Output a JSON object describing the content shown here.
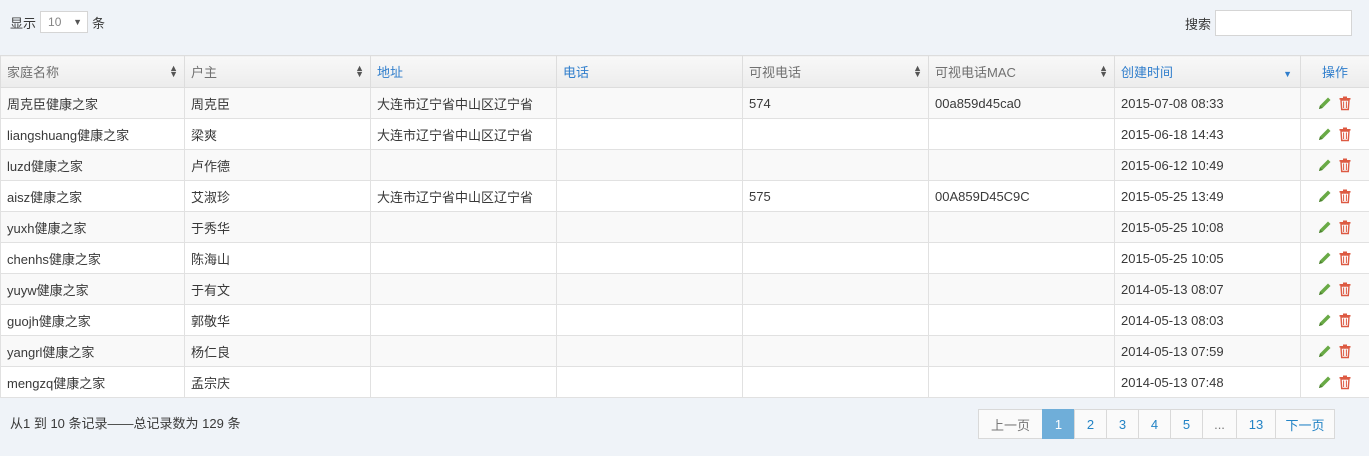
{
  "toolbar": {
    "length_prefix": "显示",
    "length_value": "10",
    "length_suffix": "条",
    "search_label": "搜索",
    "search_value": ""
  },
  "table": {
    "columns": [
      {
        "label": "家庭名称"
      },
      {
        "label": "户主"
      },
      {
        "label": "地址"
      },
      {
        "label": "电话"
      },
      {
        "label": "可视电话"
      },
      {
        "label": "可视电话MAC"
      },
      {
        "label": "创建时间"
      },
      {
        "label": "操作"
      }
    ],
    "rows": [
      {
        "family": "周克臣健康之家",
        "owner": "周克臣",
        "address": "大连市辽宁省中山区辽宁省",
        "phone": "",
        "video_phone": "574",
        "mac": "00a859d45ca0",
        "created": "2015-07-08 08:33"
      },
      {
        "family": "liangshuang健康之家",
        "owner": "梁爽",
        "address": "大连市辽宁省中山区辽宁省",
        "phone": "",
        "video_phone": "",
        "mac": "",
        "created": "2015-06-18 14:43"
      },
      {
        "family": "luzd健康之家",
        "owner": "卢作德",
        "address": "",
        "phone": "",
        "video_phone": "",
        "mac": "",
        "created": "2015-06-12 10:49"
      },
      {
        "family": "aisz健康之家",
        "owner": "艾淑珍",
        "address": "大连市辽宁省中山区辽宁省",
        "phone": "",
        "video_phone": "575",
        "mac": "00A859D45C9C",
        "created": "2015-05-25 13:49"
      },
      {
        "family": "yuxh健康之家",
        "owner": "于秀华",
        "address": "",
        "phone": "",
        "video_phone": "",
        "mac": "",
        "created": "2015-05-25 10:08"
      },
      {
        "family": "chenhs健康之家",
        "owner": "陈海山",
        "address": "",
        "phone": "",
        "video_phone": "",
        "mac": "",
        "created": "2015-05-25 10:05"
      },
      {
        "family": "yuyw健康之家",
        "owner": "于有文",
        "address": "",
        "phone": "",
        "video_phone": "",
        "mac": "",
        "created": "2014-05-13 08:07"
      },
      {
        "family": "guojh健康之家",
        "owner": "郭敬华",
        "address": "",
        "phone": "",
        "video_phone": "",
        "mac": "",
        "created": "2014-05-13 08:03"
      },
      {
        "family": "yangrl健康之家",
        "owner": "杨仁良",
        "address": "",
        "phone": "",
        "video_phone": "",
        "mac": "",
        "created": "2014-05-13 07:59"
      },
      {
        "family": "mengzq健康之家",
        "owner": "孟宗庆",
        "address": "",
        "phone": "",
        "video_phone": "",
        "mac": "",
        "created": "2014-05-13 07:48"
      }
    ],
    "row_actions": [
      {
        "icon": "pencil-icon",
        "color": "#69aa46"
      },
      {
        "icon": "trash-icon",
        "color": "#dd5a43"
      }
    ]
  },
  "footer": {
    "info": "从1 到 10 条记录——总记录数为 129 条",
    "pagination": [
      {
        "label": "上一页",
        "state": "disabled"
      },
      {
        "label": "1",
        "state": "active"
      },
      {
        "label": "2",
        "state": "normal"
      },
      {
        "label": "3",
        "state": "normal"
      },
      {
        "label": "4",
        "state": "normal"
      },
      {
        "label": "5",
        "state": "normal"
      },
      {
        "label": "...",
        "state": "disabled"
      },
      {
        "label": "13",
        "state": "normal"
      },
      {
        "label": "下一页",
        "state": "normal"
      }
    ]
  },
  "colors": {
    "link_blue": "#2283c5",
    "header_blue": "#307ecc",
    "active_page": "#6faed9",
    "edit_green": "#69aa46",
    "delete_red": "#dd5a43"
  }
}
